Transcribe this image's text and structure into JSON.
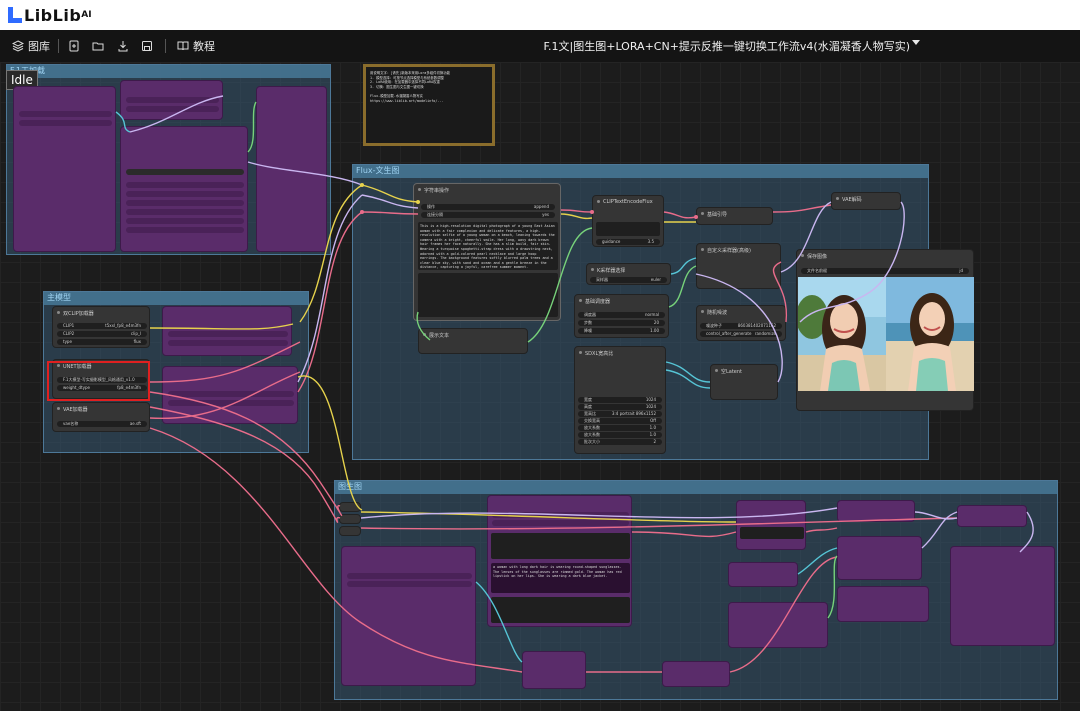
{
  "brand": {
    "name": "LibLib",
    "sup": "AI"
  },
  "toolbar": {
    "library_label": "图库",
    "tutorial_label": "教程",
    "workflow_title": "F.1文|图生图+LORA+CN+提示反推一键切换工作流v4(水湄凝香人物写实)"
  },
  "status": {
    "idle": "Idle"
  },
  "groups": {
    "flux_load": "F.1工加载",
    "main_model": "主模型",
    "flux_t2i": "Flux-文生图",
    "i2i": "图生图"
  },
  "nodes": {
    "note_text": "用说明文字：[请先]新版本采用Lora多组件切换功能\n1. 模型选择：可按节点选择模型与系统参数调整\n2. LoRA使用：在加载器中选择不同LoRA权重\n3. 切换：图生图与文生图一键切换\n\nFlux-模型加载-水湄凝香人物写实\nhttps://www.liblib.art/modelinfo/...",
    "unet_loader": "双CLIP加载器",
    "clip1_label": "CLIP1",
    "clip1_value": "t5xxl_fp8_e4m3fn",
    "clip2_label": "CLIP2",
    "clip2_value": "clip_l",
    "type_label": "type",
    "type_value": "flux",
    "unet_title": "UNET加载器",
    "unet_model_value": "F.1大模型-写实摄影模型_风格通用_v1.0",
    "weight_dtype_label": "weight_dtype",
    "weight_dtype_value": "fp8_e4m3fn",
    "vae_title": "VAE加载器",
    "vae_label": "vae名称",
    "vae_value": "ae.sft",
    "string_concat": "字符串操作",
    "op_label": "操作",
    "op_value": "append",
    "delim_label": "连接分隔",
    "delim_value": "yes",
    "prompt_text": "This is a high-resolution digital photograph of a young East Asian woman with a fair complexion and delicate features, a high-resolution selfie of a young woman on a beach, leaning towards the camera with a bright, cheerful smile. Her long, wavy dark brown hair frames her face naturally. She has a slim build, fair skin. Wearing a turquoise spaghetti-strap dress with a drawstring neck, adorned with a gold-colored pearl necklace and large hoop earrings. The background features softly blurred palm trees and a clear blue sky, with sand and ocean and a gentle breeze in the distance, capturing a joyful, carefree summer moment.",
    "show_text": "展示文本",
    "clip_encode": "CLIPTextEncodeFlux",
    "guidance_label": "guidance",
    "guidance_value": "3.5",
    "sampler_select": "K采样器选择",
    "sampler_label": "采样器",
    "sampler_value": "euler",
    "scheduler_title": "基础调度器",
    "scheduler_label": "调度器",
    "scheduler_value": "normal",
    "steps_label": "步数",
    "steps_value": "20",
    "denoise_label": "降噪",
    "denoise_value": "1.00",
    "sdxl_res": "SDXL宽高比",
    "width_label": "宽度",
    "width_value": "1024",
    "height_label": "高度",
    "height_value": "1024",
    "ratio_label": "宽高比",
    "ratio_value": "3:4 portrait 896x1152",
    "swap_label": "交换宽高",
    "swap_value": "Off",
    "up_w_label": "放大系数",
    "up_w_value": "1.0",
    "up_h_label": "放大系数",
    "up_h_value": "1.0",
    "batch_label": "批次大小",
    "batch_value": "2",
    "basic_guider": "基础引导",
    "custom_sampler": "自定义采样器(高级)",
    "random_noise": "随机噪波",
    "noise_seed_label": "噪波种子",
    "noise_seed_value": "860381402071162",
    "control_label": "control_after_generate",
    "control_value": "randomize",
    "empty_latent": "空Latent",
    "vae_decode": "VAE解码",
    "save_image": "保存图像",
    "filename_prefix_label": "文件名前缀",
    "filename_prefix_value": "jd",
    "i2i_prompt_text": "a woman with long dark hair is wearing round-shaped sunglasses. The lenses of the sunglasses are rimmed gold. The woman has red lipstick on her lips. She is wearing a dark blue jacket."
  },
  "colors": {
    "wire_pink": "#e86c8a",
    "wire_yellow": "#e6d24c",
    "wire_lavender": "#c9b6f0",
    "wire_green": "#77d27a",
    "wire_cyan": "#56c5d6",
    "group_border": "#4d7898",
    "node_purple": "#5a2c6a"
  }
}
